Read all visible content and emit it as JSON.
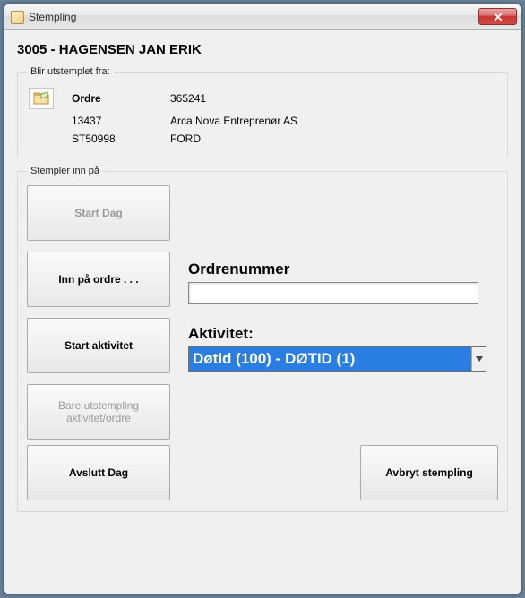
{
  "window": {
    "title": "Stempling"
  },
  "employee": "3005 - HAGENSEN JAN ERIK",
  "clock_out": {
    "legend": "Blir utstemplet fra:",
    "order_label": "Ordre",
    "order_number": "365241",
    "row2_code": "13437",
    "row2_text": "Arca Nova Entreprenør AS",
    "row3_code": "ST50998",
    "row3_text": "FORD"
  },
  "clock_in": {
    "legend": "Stempler inn på",
    "start_day": "Start Dag",
    "enter_order": "Inn på ordre . . .",
    "start_activity": "Start aktivitet",
    "order_label": "Ordrenummer",
    "order_value": "",
    "activity_label": "Aktivitet:",
    "activity_selected": "Døtid (100) - DØTID (1)"
  },
  "footer": {
    "only_out": "Bare utstempling aktivitet/ordre",
    "end_day": "Avslutt Dag",
    "cancel": "Avbryt stempling"
  }
}
